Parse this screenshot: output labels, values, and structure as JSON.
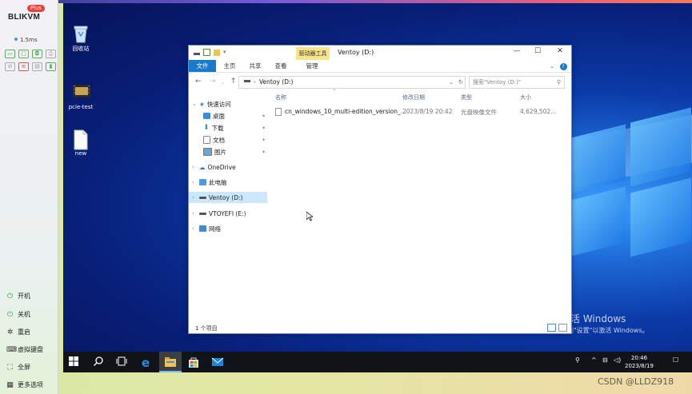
{
  "app": {
    "brand": "BLIKVM",
    "badge": "Plus",
    "latency": "1.5ms"
  },
  "panel_menu": [
    {
      "icon": "power-on-icon",
      "label": "开机"
    },
    {
      "icon": "power-off-icon",
      "label": "关机"
    },
    {
      "icon": "restart-icon",
      "label": "重启"
    },
    {
      "icon": "keyboard-icon",
      "label": "虚拟键盘"
    },
    {
      "icon": "fullscreen-icon",
      "label": "全屏"
    },
    {
      "icon": "more-icon",
      "label": "更多选项"
    }
  ],
  "desktop": {
    "icons": [
      {
        "label": "回收站",
        "icon": "recycle-bin-icon"
      },
      {
        "label": "pcie-test",
        "icon": "video-file-icon"
      },
      {
        "label": "new",
        "icon": "text-file-icon"
      }
    ],
    "activation_title": "激活 Windows",
    "activation_text": "转到\"设置\"以激活 Windows。"
  },
  "explorer": {
    "tool_tab": "驱动器工具",
    "title": "Ventoy (D:)",
    "ribbon_tabs": [
      "文件",
      "主页",
      "共享",
      "查看",
      "管理"
    ],
    "address": "Ventoy (D:)",
    "search_placeholder": "搜索\"Ventoy (D:)\"",
    "tree": {
      "quick_access": "快速访问",
      "quick_items": [
        "桌面",
        "下载",
        "文档",
        "图片"
      ],
      "onedrive": "OneDrive",
      "this_pc": "此电脑",
      "ventoy": "Ventoy (D:)",
      "vtoyefi": "VTOYEFI (E:)",
      "network": "网络"
    },
    "columns": {
      "name": "名称",
      "date": "修改日期",
      "type": "类型",
      "size": "大小"
    },
    "files": [
      {
        "name": "cn_windows_10_multi-edition_version_...",
        "date": "2023/8/19 20:42",
        "type": "光盘映像文件",
        "size": "4,629,502..."
      }
    ],
    "status": "1 个项目"
  },
  "taskbar": {
    "time": "20:46",
    "date": "2023/8/19"
  },
  "watermark": "CSDN @LLDZ918",
  "colors": {
    "accent": "#1979ca",
    "tool_tab": "#f6e58a",
    "selection": "#cce8ff"
  }
}
